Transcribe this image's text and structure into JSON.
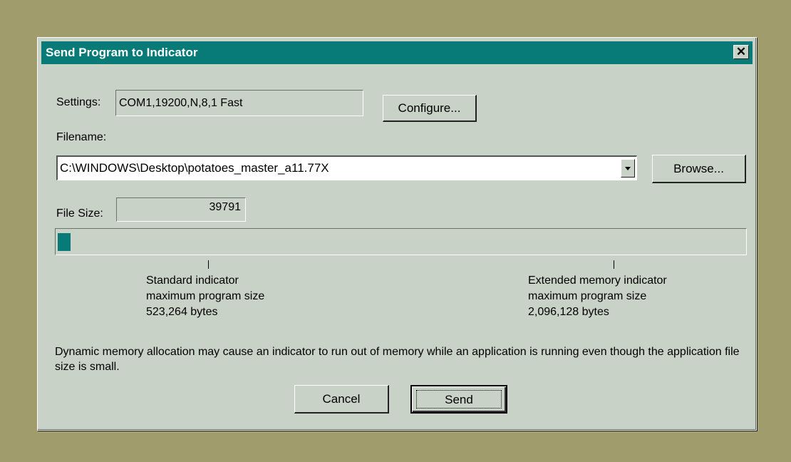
{
  "window": {
    "title": "Send Program to Indicator",
    "close_glyph": "✕"
  },
  "settings": {
    "label": "Settings:",
    "value": "COM1,19200,N,8,1  Fast",
    "configure_button": "Configure..."
  },
  "filename": {
    "label": "Filename:",
    "value": "C:\\WINDOWS\\Desktop\\potatoes_master_a11.77X",
    "browse_button": "Browse..."
  },
  "file_size": {
    "label": "File Size:",
    "value": "39791"
  },
  "progress": {
    "value_fraction": 0.019,
    "color": "#087b78"
  },
  "standard_indicator": {
    "line1": "Standard indicator",
    "line2": "maximum program size",
    "line3": "523,264 bytes"
  },
  "extended_indicator": {
    "line1": "Extended memory indicator",
    "line2": "maximum program size",
    "line3": "2,096,128 bytes"
  },
  "note": "Dynamic memory allocation may cause an indicator to run out of memory while an application is running even though the application file size is small.",
  "buttons": {
    "cancel": "Cancel",
    "send": "Send"
  },
  "colors": {
    "background": "#a09c6b",
    "dialog": "#c9d2c6",
    "titlebar": "#087b78"
  }
}
